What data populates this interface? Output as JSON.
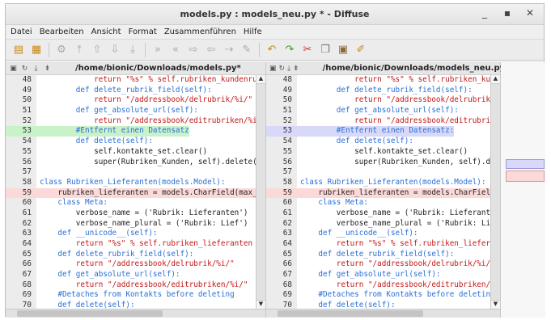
{
  "window": {
    "title": "models.py : models_neu.py * - Diffuse",
    "controls": [
      "_",
      "▪",
      "✕"
    ]
  },
  "menu": [
    "Datei",
    "Bearbeiten",
    "Ansicht",
    "Format",
    "Zusammenführen",
    "Hilfe"
  ],
  "toolbar_icons": [
    "new-file-icon",
    "open-file-icon",
    "realign-icon",
    "first-difference-icon",
    "previous-difference-icon",
    "next-difference-icon",
    "last-difference-icon",
    "goto-line-icon",
    "merge-left-icon",
    "merge-right-icon",
    "merge-all-left-icon",
    "merge-all-right-icon",
    "clear-edits-icon",
    "undo-icon",
    "redo-icon",
    "cut-icon",
    "copy-icon",
    "paste-icon",
    "clear-icon"
  ],
  "left_pane": {
    "path": "/home/bionic/Downloads/models.py*"
  },
  "right_pane": {
    "path": "/home/bionic/Downloads/models_neu.py"
  },
  "lines": [
    {
      "n": "48",
      "left": "            return \"%s\" % self.rubriken_kundenrubrik",
      "right": "            return \"%s\" % self.rubriken_kundenrubrik",
      "state": ""
    },
    {
      "n": "49",
      "left": "        def delete_rubrik_field(self):",
      "right": "        def delete_rubrik_field(self):",
      "state": ""
    },
    {
      "n": "50",
      "left": "            return \"/addressbook/delrubrik/%i/\"",
      "right": "            return \"/addressbook/delrubrik/%i/\"",
      "state": ""
    },
    {
      "n": "51",
      "left": "        def get_absolute_url(self):",
      "right": "        def get_absolute_url(self):",
      "state": ""
    },
    {
      "n": "52",
      "left": "            return \"/addressbook/editrubriken/%i/\"",
      "right": "            return \"/addressbook/editrubriken/%i/\"",
      "state": ""
    },
    {
      "n": "53",
      "left": "        #Entfernt einen Datensatz",
      "right": "        #Entfernt einen Datensatz:",
      "state": "chg"
    },
    {
      "n": "54",
      "left": "        def delete(self):",
      "right": "        def delete(self):",
      "state": ""
    },
    {
      "n": "55",
      "left": "            self.kontakte_set.clear()",
      "right": "            self.kontakte_set.clear()",
      "state": ""
    },
    {
      "n": "56",
      "left": "            super(Rubriken_Kunden, self).delete()",
      "right": "            super(Rubriken_Kunden, self).delete()",
      "state": ""
    },
    {
      "n": "57",
      "left": "",
      "right": "",
      "state": ""
    },
    {
      "n": "58",
      "left": "class Rubriken_Lieferanten(models.Model):",
      "right": "class Rubriken_Lieferanten(models.Model):",
      "state": ""
    },
    {
      "n": "59",
      "left": "    rubriken_lieferanten = models.CharField(max_",
      "right": "    rubriken_lieferanten = models.CharField(max_",
      "state": "del"
    },
    {
      "n": "60",
      "left": "    class Meta:",
      "right": "    class Meta:",
      "state": ""
    },
    {
      "n": "61",
      "left": "        verbose_name = ('Rubrik: Lieferanten')",
      "right": "        verbose_name = ('Rubrik: Lieferanten')",
      "state": ""
    },
    {
      "n": "62",
      "left": "        verbose_name_plural = ('Rubrik: Lief')",
      "right": "        verbose_name_plural = ('Rubrik: Lief')",
      "state": ""
    },
    {
      "n": "63",
      "left": "    def __unicode__(self):",
      "right": "    def __unicode__(self):",
      "state": ""
    },
    {
      "n": "64",
      "left": "        return \"%s\" % self.rubriken_lieferanten",
      "right": "        return \"%s\" % self.rubriken_lieferanten",
      "state": ""
    },
    {
      "n": "65",
      "left": "    def delete_rubrik_field(self):",
      "right": "    def delete_rubrik_field(self):",
      "state": ""
    },
    {
      "n": "66",
      "left": "        return \"/addressbook/delrubrik/%i/\"",
      "right": "        return \"/addressbook/delrubrik/%i/\"",
      "state": ""
    },
    {
      "n": "67",
      "left": "    def get_absolute_url(self):",
      "right": "    def get_absolute_url(self):",
      "state": ""
    },
    {
      "n": "68",
      "left": "        return \"/addressbook/editrubriken/%i/\"",
      "right": "        return \"/addressbook/editrubriken/%i/\"",
      "state": ""
    },
    {
      "n": "69",
      "left": "    #Detaches from Kontakts before deleting",
      "right": "    #Detaches from Kontakts before deleting",
      "state": ""
    },
    {
      "n": "70",
      "left": "    def delete(self):",
      "right": "    def delete(self):",
      "state": ""
    }
  ],
  "colors": {
    "changed_left": "#c9f2c9",
    "changed_right": "#d8d8f8",
    "modified_line": "#fcd9d9",
    "keyword": "#2a6fd6",
    "string": "#c21818"
  }
}
